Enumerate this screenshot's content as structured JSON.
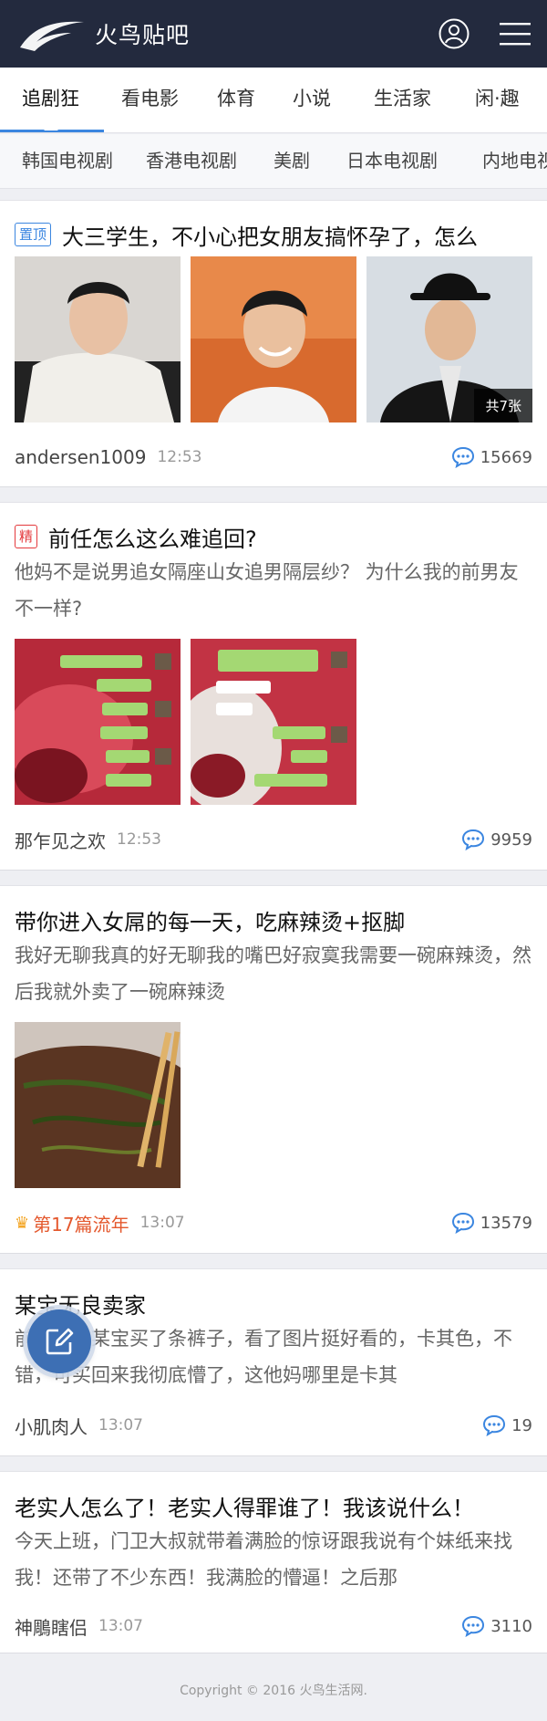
{
  "header": {
    "app_name": "火鸟贴吧",
    "icons": [
      "logo-icon",
      "user-icon",
      "menu-icon"
    ]
  },
  "primary_tabs": [
    {
      "label": "追剧狂",
      "active": true
    },
    {
      "label": "看电影"
    },
    {
      "label": "体育"
    },
    {
      "label": "小说"
    },
    {
      "label": "生活家"
    },
    {
      "label": "闲·趣"
    }
  ],
  "secondary_tabs": [
    {
      "label": "韩国电视剧"
    },
    {
      "label": "香港电视剧"
    },
    {
      "label": "美剧"
    },
    {
      "label": "日本电视剧"
    },
    {
      "label": "内地电视剧"
    }
  ],
  "posts": [
    {
      "tag": "置顶",
      "title": "大三学生，不小心把女朋友搞怀孕了，怎么",
      "image_count_label": "共7张",
      "author": "andersen1009",
      "time": "12:53",
      "replies": "15669"
    },
    {
      "tag": "精",
      "title": "前任怎么这么难追回?",
      "summary": "他妈不是说男追女隔座山女追男隔层纱？ 为什么我的前男友不一样?",
      "author": "那乍见之欢",
      "time": "12:53",
      "replies": "9959"
    },
    {
      "title": "带你进入女屌的每一天，吃麻辣烫+抠脚",
      "summary": "我好无聊我真的好无聊我的嘴巴好寂寞我需要一碗麻辣烫，然后我就外卖了一碗麻辣烫",
      "author": "第17篇流年",
      "time": "13:07",
      "replies": "13579"
    },
    {
      "title": "某宝无良卖家",
      "summary": "前几天在某宝买了条裤子，看了图片挺好看的，卡其色，不错，可买回来我彻底懵了，这他妈哪里是卡其",
      "author": "小肌肉人",
      "time": "13:07",
      "replies": "19"
    },
    {
      "title": "老实人怎么了！老实人得罪谁了！我该说什么！",
      "summary": "今天上班，门卫大叔就带着满脸的惊讶跟我说有个妹纸来找我！还带了不少东西！我满脸的懵逼！之后那",
      "author": "神鵰瞎侣",
      "time": "13:07",
      "replies": "3110"
    }
  ],
  "footer": {
    "copyright": "Copyright © 2016 火鸟生活网."
  },
  "colors": {
    "header_bg": "#232a3e",
    "accent": "#3b86e0",
    "tag_red": "#e4393c",
    "vip_orange": "#e4582d",
    "fab": "#3d6fb4"
  }
}
